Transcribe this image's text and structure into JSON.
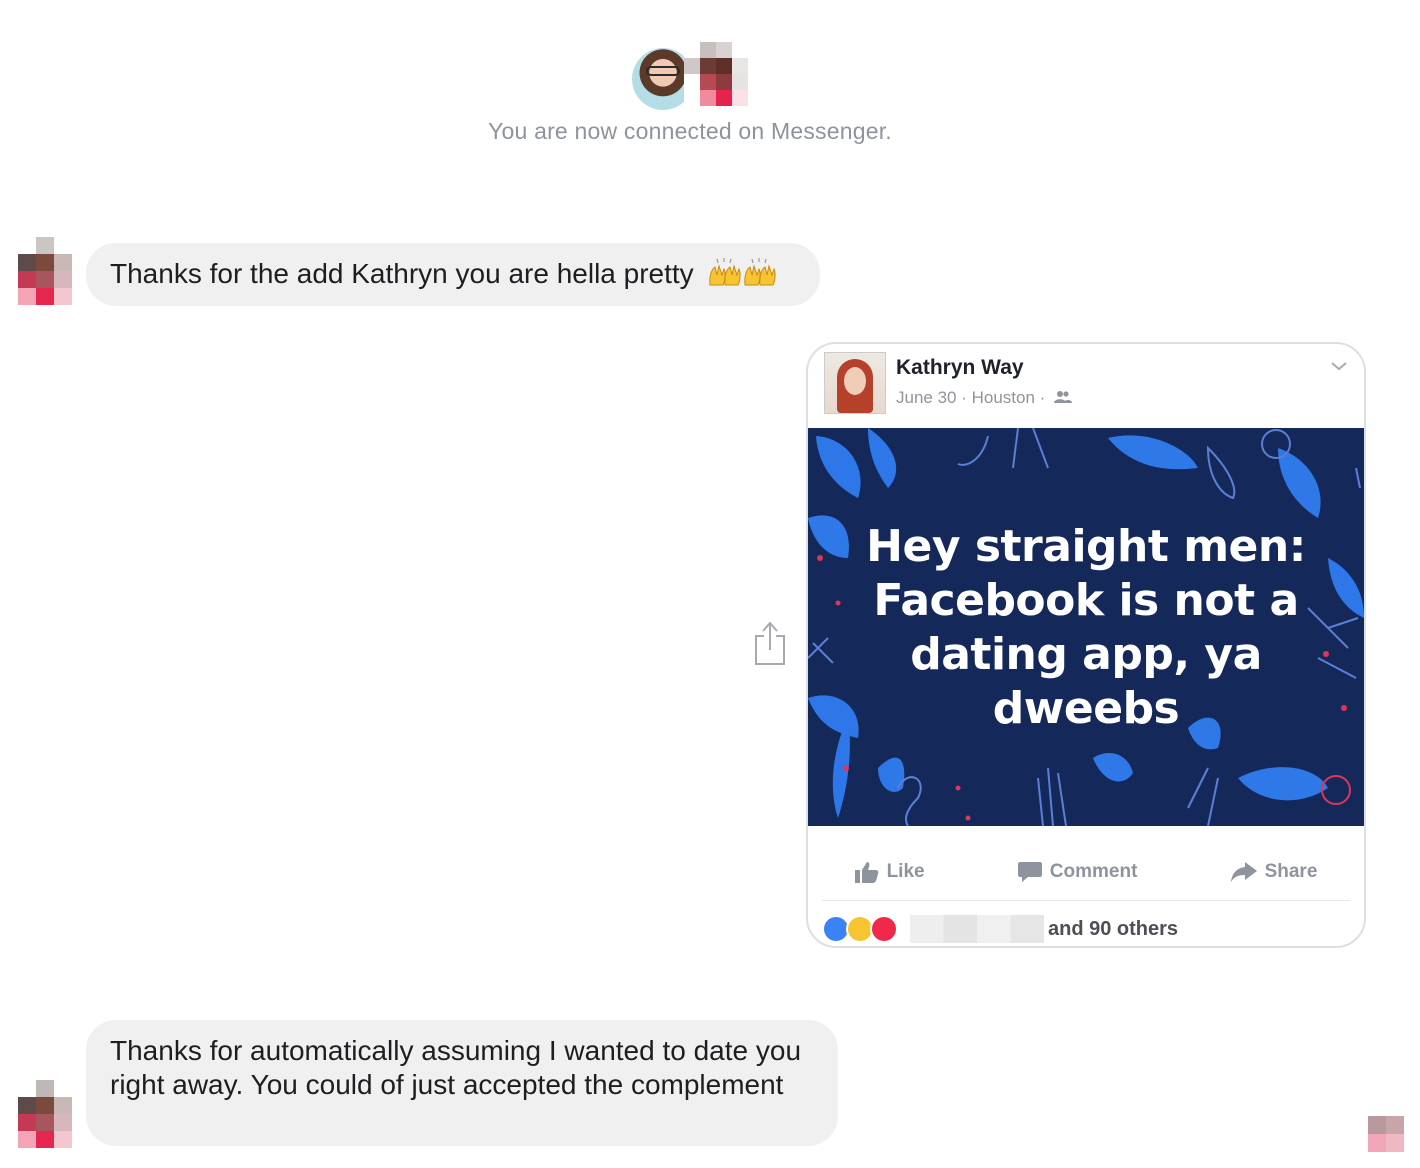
{
  "connection": {
    "text": "You are now connected on Messenger."
  },
  "messages": [
    {
      "sender": "other",
      "text": "Thanks for the add Kathryn you are hella pretty",
      "emoji": "raised-hands-emoji x2"
    },
    {
      "sender": "other",
      "text": "Thanks for automatically assuming I wanted to date you right away. You could of just accepted the complement"
    }
  ],
  "shared_post": {
    "author": "Kathryn Way",
    "meta": "June 30 · Houston ·",
    "image_text": "Hey straight men: Facebook is not a dating app, ya dweebs",
    "actions": {
      "like": "Like",
      "comment": "Comment",
      "share": "Share"
    },
    "reactions_text": "and 90 others",
    "reaction_icons": [
      "like-reaction-icon",
      "haha-reaction-icon",
      "love-reaction-icon"
    ]
  },
  "colors": {
    "bubble": "#f1f0f0",
    "post_bg": "#15285a",
    "accent_blue": "#2f7cf0",
    "meta_gray": "#8d949e"
  }
}
